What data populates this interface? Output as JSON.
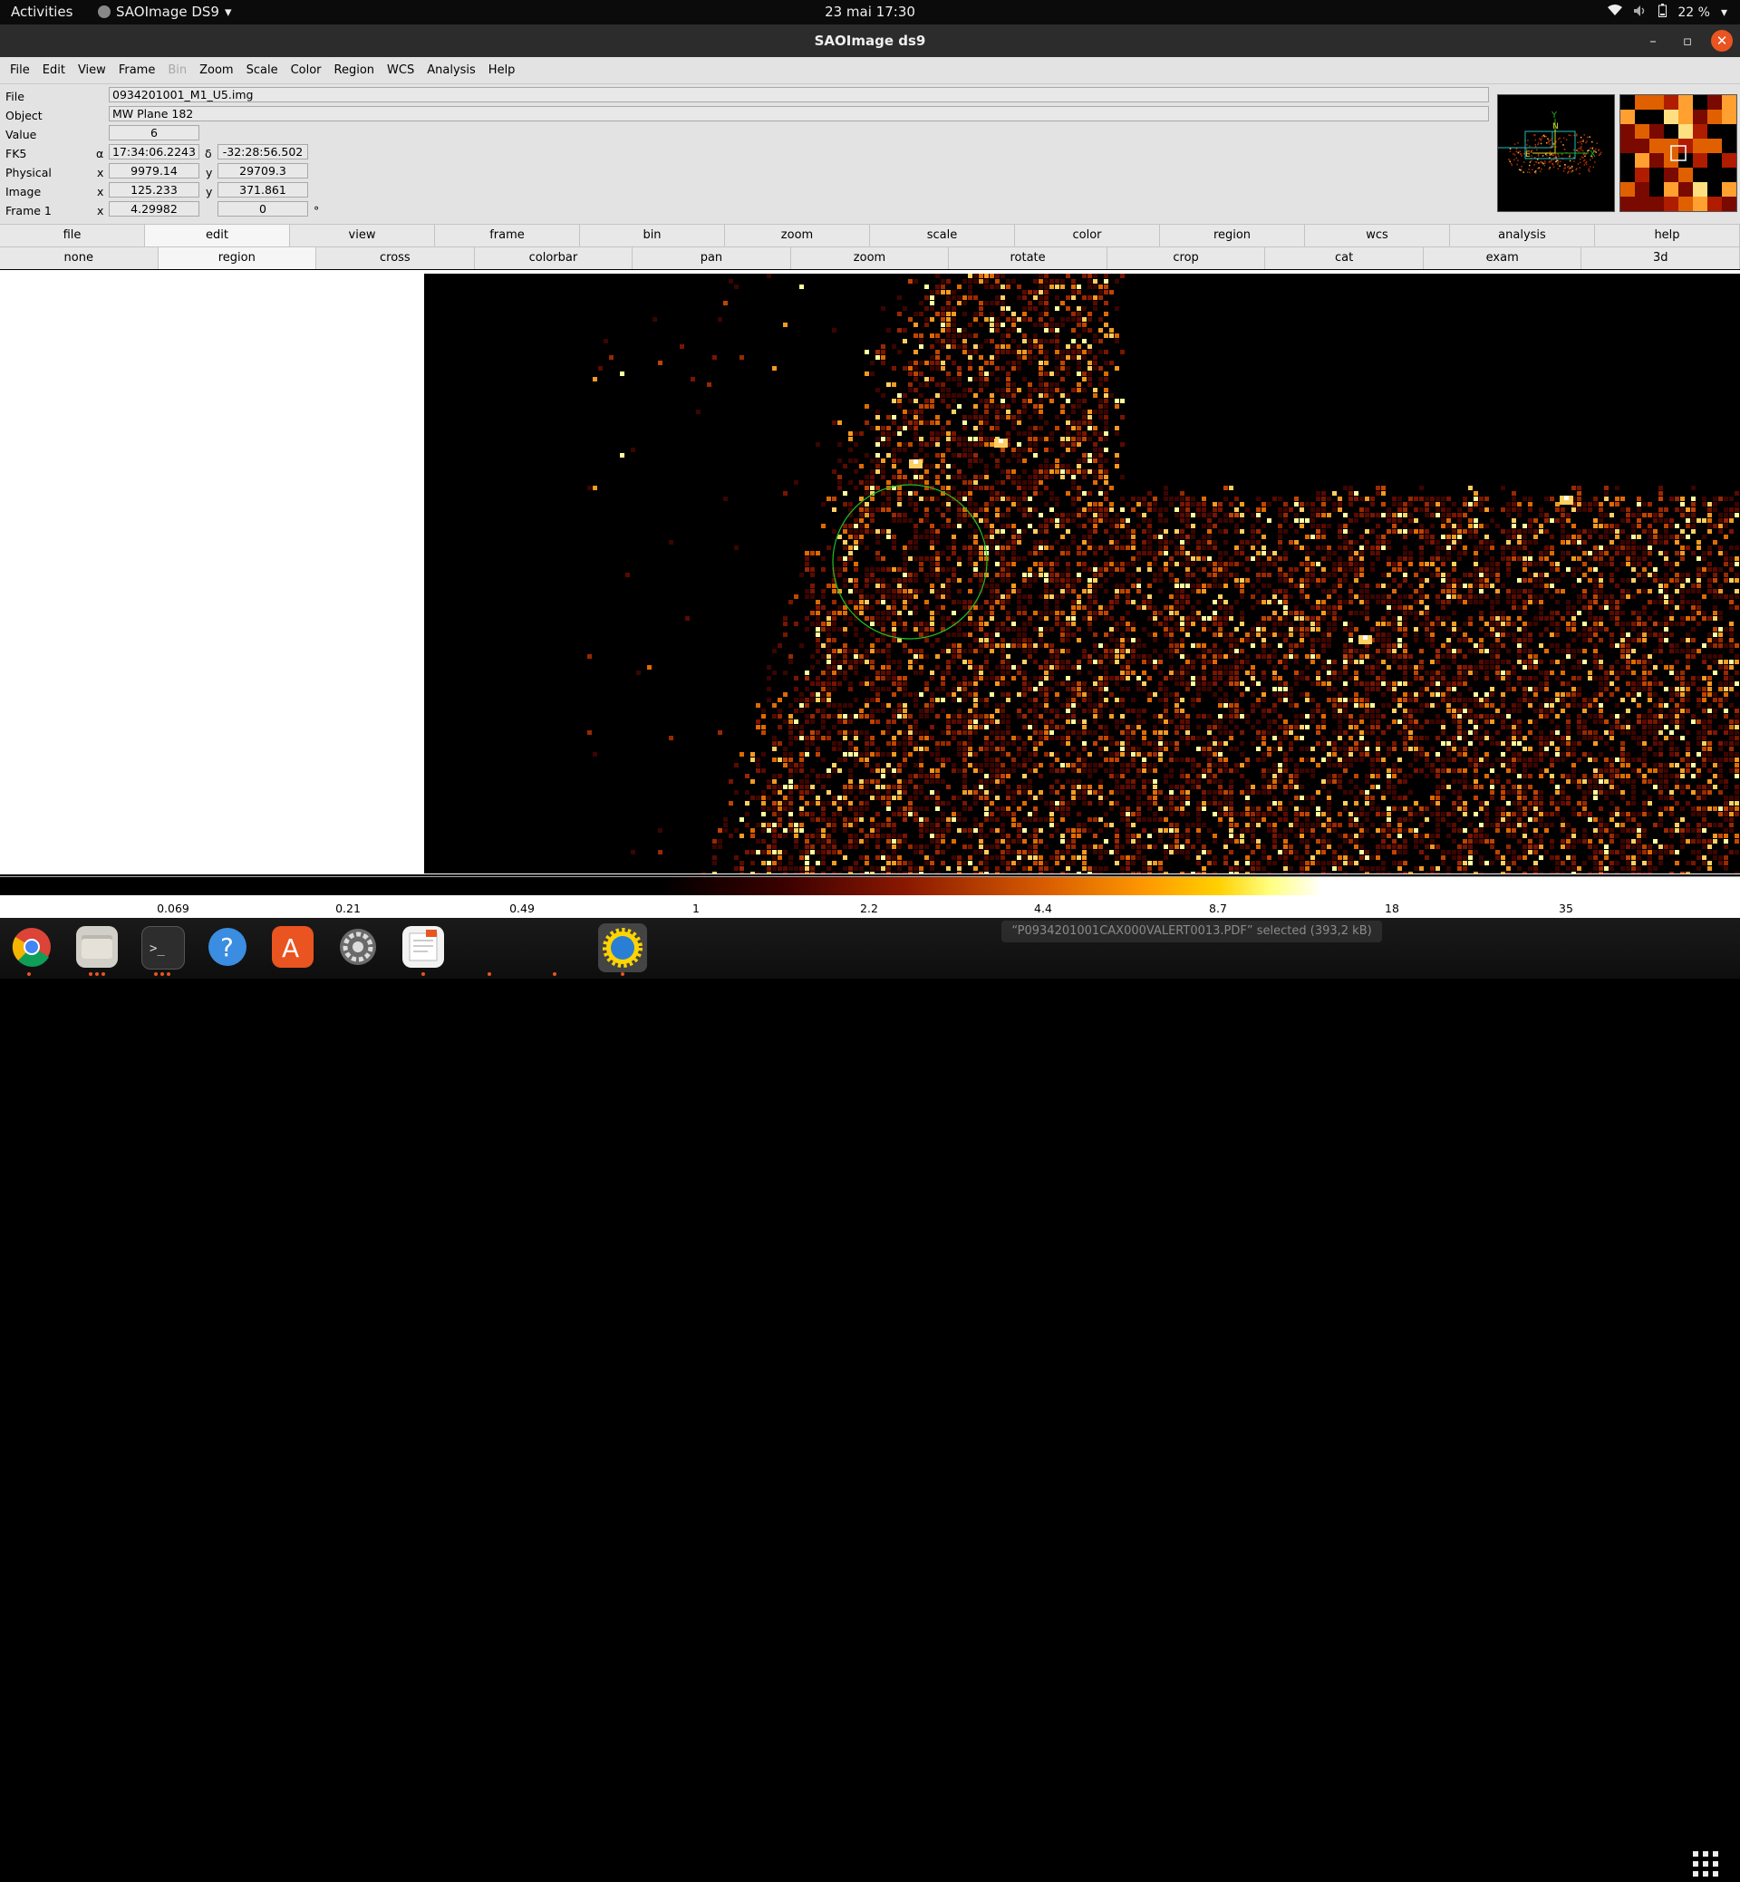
{
  "topbar": {
    "activities": "Activities",
    "app_name": "SAOImage DS9",
    "clock": "23 mai  17:30",
    "battery": "22 %"
  },
  "window": {
    "title": "SAOImage ds9"
  },
  "menu": [
    "File",
    "Edit",
    "View",
    "Frame",
    "Bin",
    "Zoom",
    "Scale",
    "Color",
    "Region",
    "WCS",
    "Analysis",
    "Help"
  ],
  "info": {
    "file_label": "File",
    "file_value": "0934201001_M1_U5.img",
    "object_label": "Object",
    "object_value": "MW Plane 182",
    "value_label": "Value",
    "value_value": "6",
    "fk5_label": "FK5",
    "alpha_sym": "α",
    "alpha_value": "17:34:06.2243",
    "delta_sym": "δ",
    "delta_value": "-32:28:56.502",
    "physical_label": "Physical",
    "physical_x": "9979.14",
    "physical_y": "29709.3",
    "image_label": "Image",
    "image_x": "125.233",
    "image_y": "371.861",
    "frame_label": "Frame 1",
    "frame_x": "4.29982",
    "frame_rot": "0",
    "x_sym": "x",
    "y_sym": "y",
    "deg_sym": "°"
  },
  "buttonbar1": [
    "file",
    "edit",
    "view",
    "frame",
    "bin",
    "zoom",
    "scale",
    "color",
    "region",
    "wcs",
    "analysis",
    "help"
  ],
  "buttonbar2": [
    "none",
    "region",
    "cross",
    "colorbar",
    "pan",
    "zoom",
    "rotate",
    "crop",
    "cat",
    "exam",
    "3d"
  ],
  "active": {
    "bar1": "edit",
    "bar2": "region"
  },
  "colorbar_ticks": [
    "0.069",
    "0.21",
    "0.49",
    "1",
    "2.2",
    "4.4",
    "8.7",
    "18",
    "35"
  ],
  "dock": {
    "notice": "“P0934201001CAX000VALERT0013.PDF” selected  (393,2 kB)",
    "icons": [
      "chrome-icon",
      "files-icon",
      "terminal-icon",
      "help-icon",
      "app-store-icon",
      "settings-icon",
      "text-editor-icon",
      "ds9-icon"
    ]
  },
  "colors": {
    "accent": "#e95420",
    "region_circle": "#22c022"
  }
}
